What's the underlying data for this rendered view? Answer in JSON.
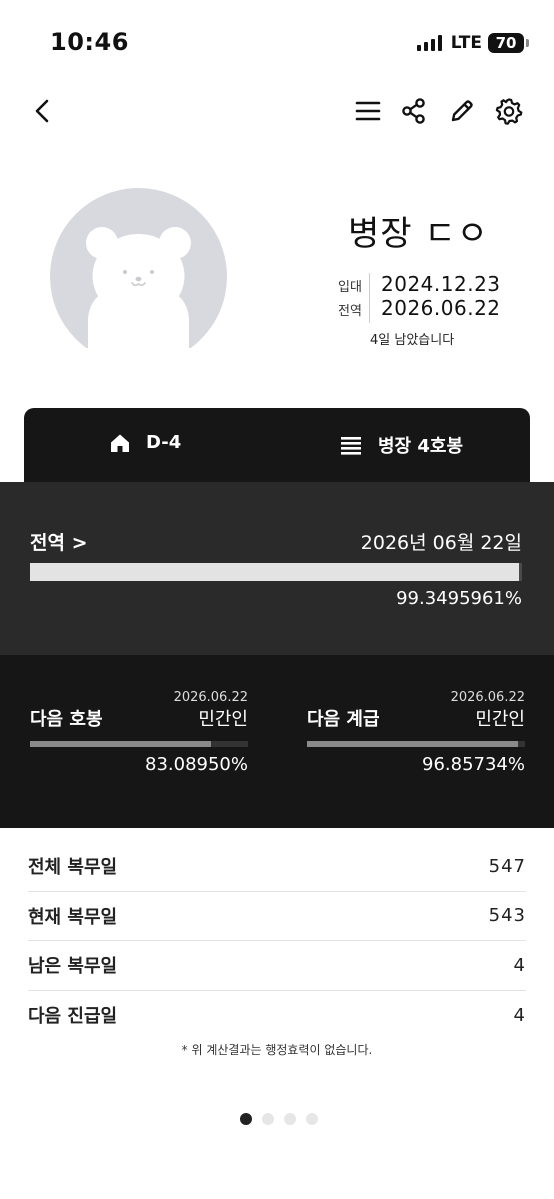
{
  "status_bar": {
    "time": "10:46",
    "network": "LTE",
    "battery": "70"
  },
  "nav": {
    "icons": [
      "chevron-left-icon",
      "menu-icon",
      "share-icon",
      "pencil-icon",
      "gear-icon"
    ]
  },
  "profile": {
    "name": "병장 ㄷㅇ",
    "enlist_label": "입대",
    "enlist_date": "2024.12.23",
    "discharge_label": "전역",
    "discharge_date": "2026.06.22",
    "remaining_text": "4일 남았습니다"
  },
  "tabs": {
    "dday": "D-4",
    "rank": "병장 4호봉"
  },
  "discharge": {
    "title": "전역 >",
    "date_text": "2026년 06월 22일",
    "progress": 0.993495961,
    "percent_text": "99.3495961%"
  },
  "next_pay": {
    "title": "다음 호봉",
    "date": "2026.06.22",
    "target": "민간인",
    "progress": 0.830895,
    "percent_text": "83.08950%"
  },
  "next_rank": {
    "title": "다음 계급",
    "date": "2026.06.22",
    "target": "민간인",
    "progress": 0.9685734,
    "percent_text": "96.85734%"
  },
  "stats": [
    {
      "label": "전체 복무일",
      "value": "547"
    },
    {
      "label": "현재 복무일",
      "value": "543"
    },
    {
      "label": "남은 복무일",
      "value": "4"
    },
    {
      "label": "다음 진급일",
      "value": "4"
    }
  ],
  "disclaimer": "* 위 계산결과는 행정효력이 없습니다.",
  "pager": {
    "count": 4,
    "active": 0
  },
  "colors": {
    "background": "#ffffff",
    "dark": "#161616",
    "mid_dark": "#2a2a2a",
    "avatar_bg": "#d7d9df"
  }
}
